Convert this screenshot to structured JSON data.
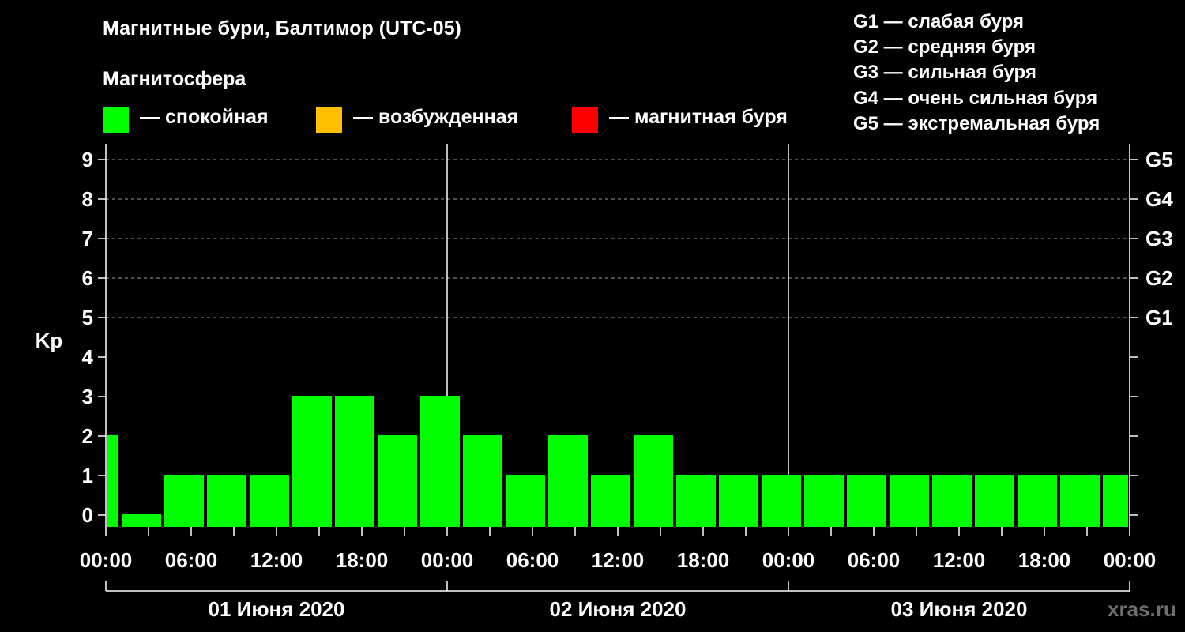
{
  "title": "Магнитные бури, Балтимор (UTC-05)",
  "subtitle": "Магнитосфера",
  "legend": [
    {
      "label": "— спокойная",
      "color": "#00ff00"
    },
    {
      "label": "— возбужденная",
      "color": "#ffc000"
    },
    {
      "label": "— магнитная буря",
      "color": "#ff0000"
    }
  ],
  "storm_scale": [
    "G1 — слабая буря",
    "G2 — средняя буря",
    "G3 — сильная буря",
    "G4 — очень сильная буря",
    "G5 — экстремальная буря"
  ],
  "watermark": "xras.ru",
  "chart_data": {
    "type": "bar",
    "ylabel": "Kp",
    "ylim": [
      0,
      9
    ],
    "yticks": [
      "0",
      "1",
      "2",
      "3",
      "4",
      "5",
      "6",
      "7",
      "8",
      "9"
    ],
    "right_ticks": [
      {
        "kp": 5,
        "label": "G1"
      },
      {
        "kp": 6,
        "label": "G2"
      },
      {
        "kp": 7,
        "label": "G3"
      },
      {
        "kp": 8,
        "label": "G4"
      },
      {
        "kp": 9,
        "label": "G5"
      }
    ],
    "grid": "dashed horizontal",
    "xlim_hours": [
      0,
      72
    ],
    "xtick_labels": [
      "00:00",
      "06:00",
      "12:00",
      "18:00",
      "00:00",
      "06:00",
      "12:00",
      "18:00",
      "00:00",
      "06:00",
      "12:00",
      "18:00",
      "00:00"
    ],
    "days": [
      "01 Июня 2020",
      "02 Июня 2020",
      "03 Июня 2020"
    ],
    "bars": [
      {
        "start": 0,
        "end": 1,
        "kp": 2
      },
      {
        "start": 1,
        "end": 4,
        "kp": 0
      },
      {
        "start": 4,
        "end": 7,
        "kp": 1
      },
      {
        "start": 7,
        "end": 10,
        "kp": 1
      },
      {
        "start": 10,
        "end": 13,
        "kp": 1
      },
      {
        "start": 13,
        "end": 16,
        "kp": 3
      },
      {
        "start": 16,
        "end": 19,
        "kp": 3
      },
      {
        "start": 19,
        "end": 22,
        "kp": 2
      },
      {
        "start": 22,
        "end": 25,
        "kp": 3
      },
      {
        "start": 25,
        "end": 28,
        "kp": 2
      },
      {
        "start": 28,
        "end": 31,
        "kp": 1
      },
      {
        "start": 31,
        "end": 34,
        "kp": 2
      },
      {
        "start": 34,
        "end": 37,
        "kp": 1
      },
      {
        "start": 37,
        "end": 40,
        "kp": 2
      },
      {
        "start": 40,
        "end": 43,
        "kp": 1
      },
      {
        "start": 43,
        "end": 46,
        "kp": 1
      },
      {
        "start": 46,
        "end": 49,
        "kp": 1
      },
      {
        "start": 49,
        "end": 52,
        "kp": 1
      },
      {
        "start": 52,
        "end": 55,
        "kp": 1
      },
      {
        "start": 55,
        "end": 58,
        "kp": 1
      },
      {
        "start": 58,
        "end": 61,
        "kp": 1
      },
      {
        "start": 61,
        "end": 64,
        "kp": 1
      },
      {
        "start": 64,
        "end": 67,
        "kp": 1
      },
      {
        "start": 67,
        "end": 70,
        "kp": 1
      },
      {
        "start": 70,
        "end": 72,
        "kp": 1
      }
    ]
  }
}
